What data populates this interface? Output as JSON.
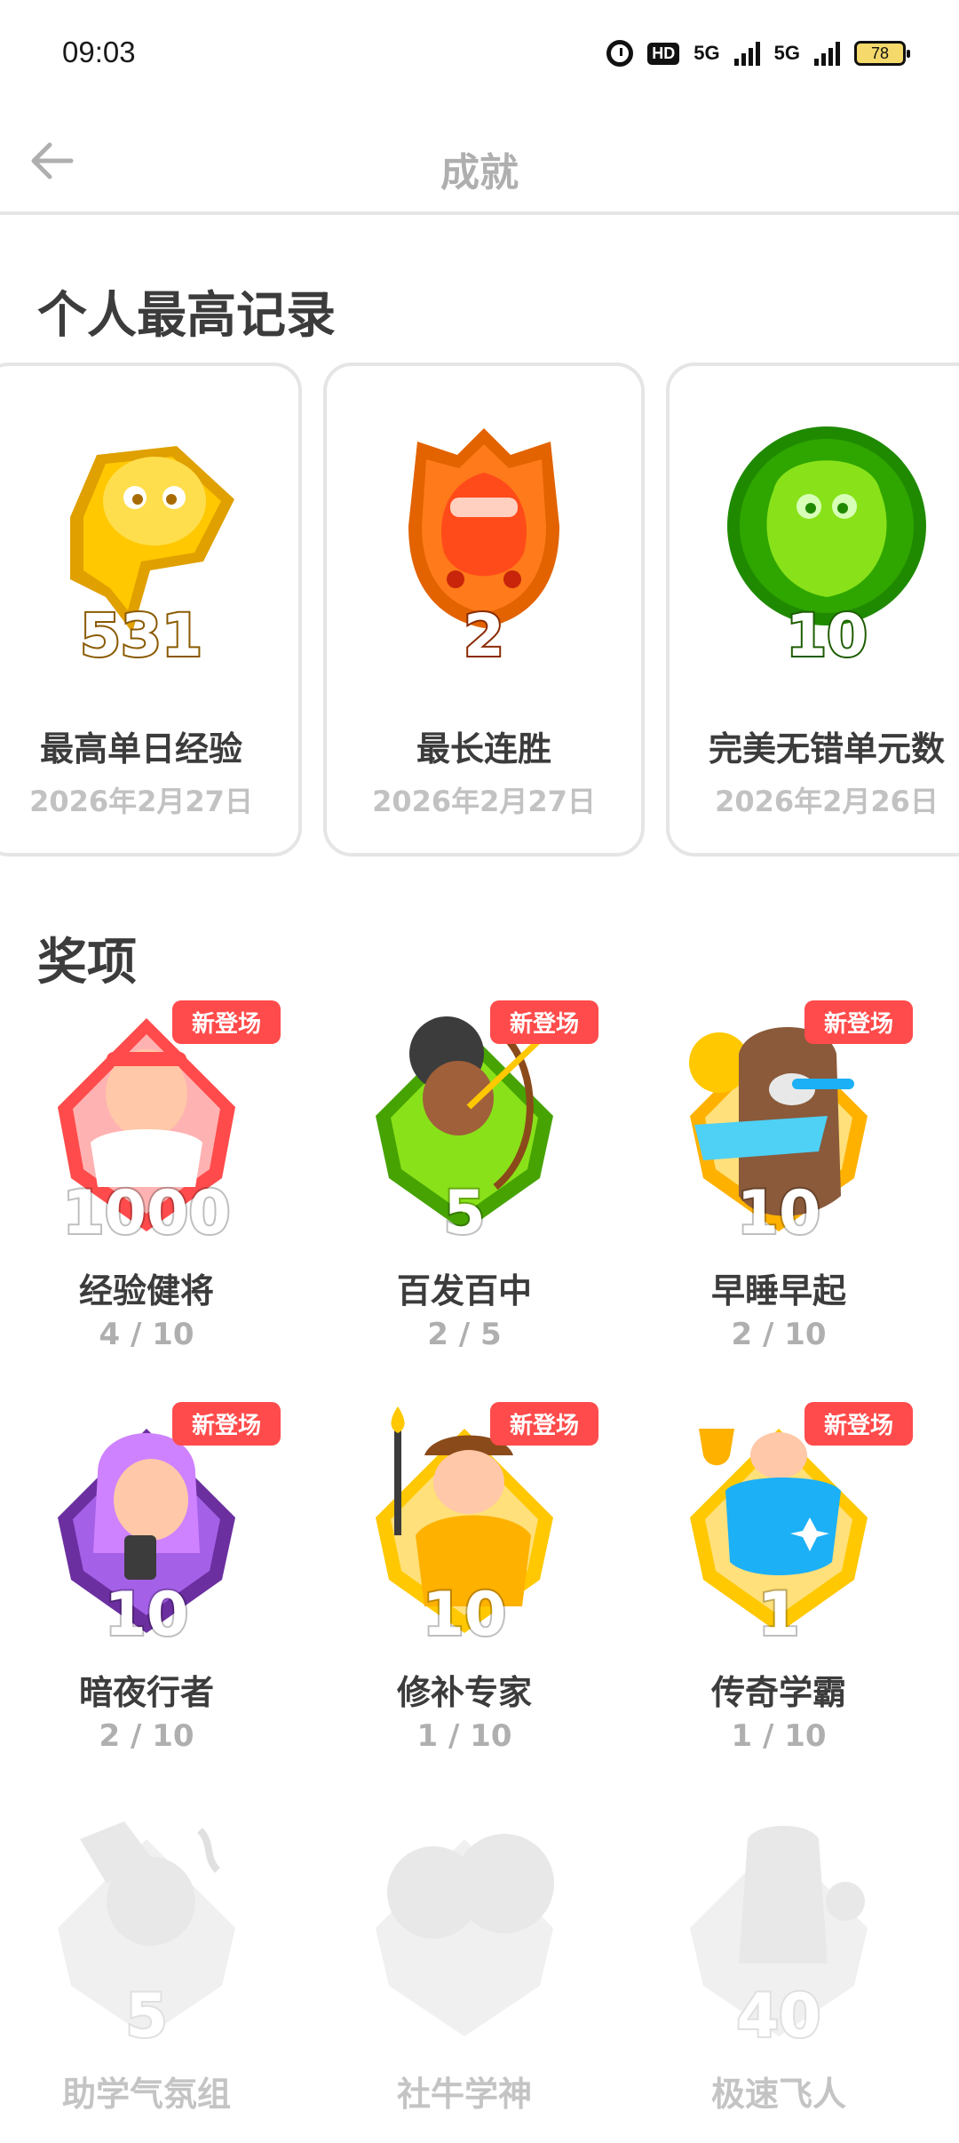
{
  "status_bar": {
    "time": "09:03",
    "hd_label": "HD",
    "net1": "5G",
    "net2": "5G",
    "battery": "78"
  },
  "header": {
    "title": "成就",
    "back_icon": "arrow-left-icon"
  },
  "records_section": {
    "title": "个人最高记录",
    "items": [
      {
        "value": "531",
        "label": "最高单日经验",
        "date": "2026年2月27日",
        "color": "#ffc800"
      },
      {
        "value": "2",
        "label": "最长连胜",
        "date": "2026年2月27日",
        "color": "#ff6a1a"
      },
      {
        "value": "10",
        "label": "完美无错单元数",
        "date": "2026年2月26日",
        "color": "#58cc02"
      }
    ]
  },
  "awards_section": {
    "title": "奖项",
    "new_tag": "新登场",
    "items": [
      {
        "level": "1000",
        "name": "经验健将",
        "progress": "4 / 10",
        "color": "#ff7878",
        "locked": false
      },
      {
        "level": "5",
        "name": "百发百中",
        "progress": "2 / 5",
        "color": "#58cc02",
        "locked": false
      },
      {
        "level": "10",
        "name": "早睡早起",
        "progress": "2 / 10",
        "color": "#ffc800",
        "locked": false
      },
      {
        "level": "10",
        "name": "暗夜行者",
        "progress": "2 / 10",
        "color": "#8549ba",
        "locked": false
      },
      {
        "level": "10",
        "name": "修补专家",
        "progress": "1 / 10",
        "color": "#ffc800",
        "locked": false
      },
      {
        "level": "1",
        "name": "传奇学霸",
        "progress": "1 / 10",
        "color": "#ffc800",
        "locked": false
      },
      {
        "level": "5",
        "name": "助学气氛组",
        "color": "#e5e5e5",
        "locked": true
      },
      {
        "level": "",
        "name": "社牛学神",
        "color": "#e5e5e5",
        "locked": true
      },
      {
        "level": "40",
        "name": "极速飞人",
        "color": "#e5e5e5",
        "locked": true
      }
    ]
  }
}
